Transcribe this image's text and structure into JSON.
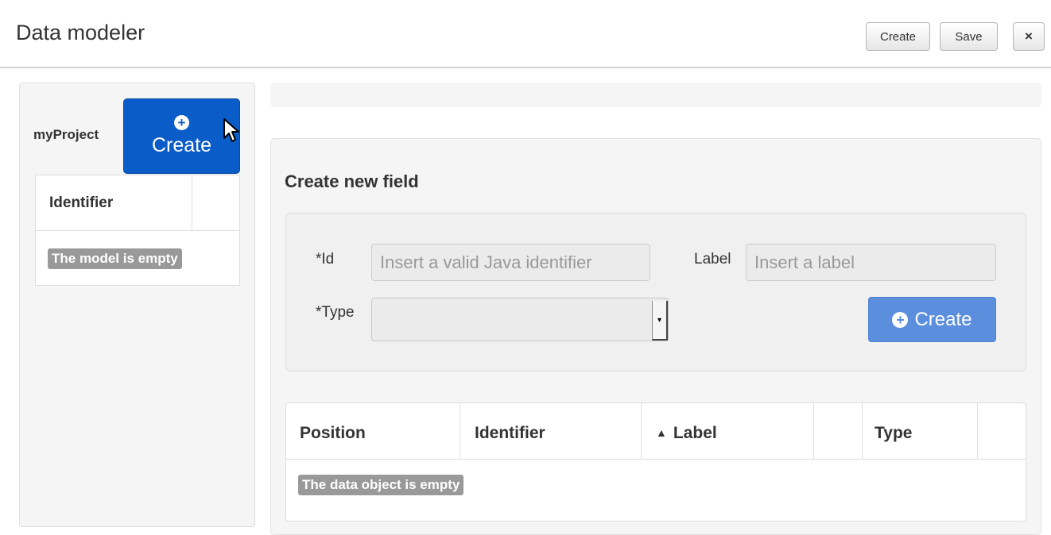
{
  "header": {
    "title": "Data modeler",
    "create_label": "Create",
    "save_label": "Save",
    "close_icon": "×"
  },
  "sidebar": {
    "project_name": "myProject",
    "create_button_label": "Create",
    "table": {
      "columns": [
        "Identifier",
        ""
      ],
      "empty_message": "The model is empty"
    }
  },
  "main": {
    "form": {
      "title": "Create new field",
      "id_label": "*Id",
      "id_placeholder": "Insert a valid Java identifier",
      "id_value": "",
      "label_label": "Label",
      "label_placeholder": "Insert a label",
      "label_value": "",
      "type_label": "*Type",
      "type_value": "",
      "create_button_label": "Create"
    },
    "fields_table": {
      "columns": [
        "Position",
        "Identifier",
        "Label",
        "",
        "Type",
        ""
      ],
      "sort_column": "Label",
      "sort_direction": "ascending",
      "empty_message": "The data object is empty"
    }
  },
  "colors": {
    "primary_button": "#0a5cc8",
    "form_create_button": "#5b8fde",
    "empty_badge": "#999999"
  }
}
